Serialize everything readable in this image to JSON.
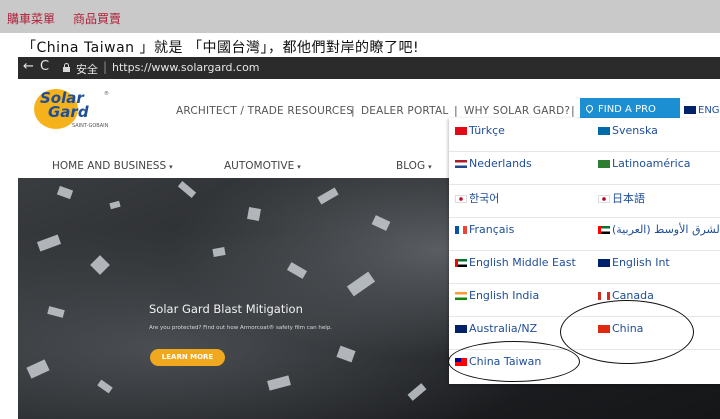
{
  "blog_nav": {
    "cart": "購車菜單",
    "bought": "商品買賣"
  },
  "caption": "「China Taiwan 」就是 「中國台灣」，都他們對岸的瞭了吧!",
  "browser": {
    "back_glyph": "←",
    "reload_glyph": "C",
    "secure_label": "安全",
    "separator": "|",
    "url": "https://www.solargard.com"
  },
  "site": {
    "logo": {
      "line1": "Solar",
      "line2": "Gard",
      "sub": "SAINT-GOBAIN",
      "tm": "®"
    },
    "top_nav": {
      "architect": "ARCHITECT / TRADE RESOURCES",
      "dealer": "DEALER PORTAL",
      "why": "WHY SOLAR GARD?",
      "find_pro": "FIND A PRO",
      "lang_current": "ENG",
      "separator": "|"
    },
    "main_nav": {
      "home": "HOME AND BUSINESS",
      "auto": "AUTOMOTIVE",
      "blog": "BLOG",
      "caret": "▾"
    },
    "hero": {
      "title": "Solar Gard Blast Mitigation",
      "subtitle": "Are you protected? Find out how Armorcoat® safety film can help.",
      "cta": "LEARN MORE"
    },
    "languages": [
      {
        "label": "Türkçe",
        "flag": "tr-flag-icon",
        "color": "#e30a17"
      },
      {
        "label": "Svenska",
        "flag": "se-flag-icon",
        "color": "#006aa7"
      },
      {
        "label": "Nederlands",
        "flag": "nl-flag-icon",
        "color": "#21468b"
      },
      {
        "label": "Latinoamérica",
        "flag": "latam-flag-icon",
        "color": "#2e7d32"
      },
      {
        "label": "한국어",
        "flag": "kr-flag-icon",
        "color": "#ffffff"
      },
      {
        "label": "日本語",
        "flag": "jp-flag-icon",
        "color": "#ffffff"
      },
      {
        "label": "Français",
        "flag": "fr-flag-icon",
        "color": "#0055a4"
      },
      {
        "label": "الشرق الأوسط (العربية)",
        "flag": "ae-flag-icon",
        "color": "#00732f"
      },
      {
        "label": "English Middle East",
        "flag": "ae-flag-icon",
        "color": "#00732f"
      },
      {
        "label": "English Int",
        "flag": "gb-flag-icon",
        "color": "#012169"
      },
      {
        "label": "English India",
        "flag": "in-flag-icon",
        "color": "#ff9933"
      },
      {
        "label": "Canada",
        "flag": "ca-flag-icon",
        "color": "#d52b1e"
      },
      {
        "label": "Australia/NZ",
        "flag": "au-flag-icon",
        "color": "#012169"
      },
      {
        "label": "China",
        "flag": "cn-flag-icon",
        "color": "#de2910"
      },
      {
        "label": "China Taiwan",
        "flag": "tw-flag-icon",
        "color": "#fe0000"
      }
    ]
  }
}
